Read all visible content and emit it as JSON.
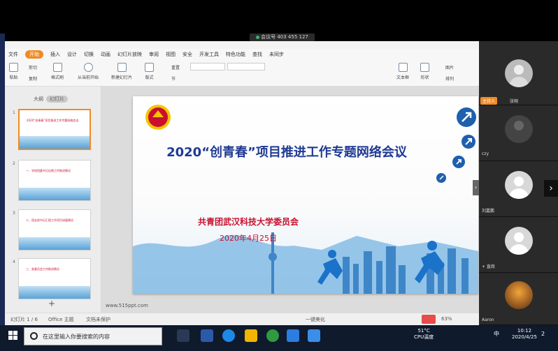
{
  "meeting": {
    "label": "会议号 403 455 127"
  },
  "menu": [
    "文件",
    "开始",
    "插入",
    "设计",
    "切换",
    "动画",
    "幻灯片放映",
    "审阅",
    "视图",
    "安全",
    "开发工具",
    "特色功能",
    "查找",
    "未同步"
  ],
  "ribbon": {
    "paste": "粘贴",
    "cut": "剪切",
    "copy": "复制",
    "format_painter": "格式刷",
    "from_current": "从当前开始",
    "new_slide": "新建幻灯片",
    "layout": "版式",
    "reset": "重置",
    "section": "节",
    "textbox": "文本框",
    "shape": "形状",
    "arrange": "排列",
    "picture": "图片"
  },
  "panel": {
    "tab_outline": "大纲",
    "tab_slides": "幻灯片",
    "add": "+"
  },
  "thumbs": [
    {
      "num": "1",
      "title": "2020“创青春”项目推进工作专题网络会议"
    },
    {
      "num": "2",
      "title": "一、学校团委书记出席工作推进情况"
    },
    {
      "num": "3",
      "title": "二、团支部书记汇报工作项目进展情况"
    },
    {
      "num": "4",
      "title": "三、各委员会工作推进情况"
    }
  ],
  "slide": {
    "title": "2020“创青春”项目推进工作专题网络会议",
    "org": "共青团武汉科技大学委员会",
    "date": "2020年4月25日",
    "logo_text": "中国共青团"
  },
  "site_url": "www.515ppt.com",
  "status": {
    "slide_info": "幻灯片 1 / 6",
    "theme": "Office 主题",
    "backup": "文档未保护",
    "beautify": "一键美化",
    "zoom": "63%"
  },
  "video": {
    "host_badge": "主持人",
    "tiles": [
      {
        "name": "张翔"
      },
      {
        "name": "czy"
      },
      {
        "name": "刘嘉鹏"
      },
      {
        "name": "+ 直商"
      },
      {
        "name": "Aaron"
      }
    ]
  },
  "taskbar": {
    "search_placeholder": "在这里输入你要搜索的内容",
    "temp": "51°C",
    "cpu": "CPU温度",
    "ime": "中",
    "time": "10:12",
    "date": "2020/4/25",
    "notif": "2"
  },
  "colors": {
    "accent": "#f08a24",
    "title_blue": "#1f3a93",
    "red": "#c8102e"
  }
}
